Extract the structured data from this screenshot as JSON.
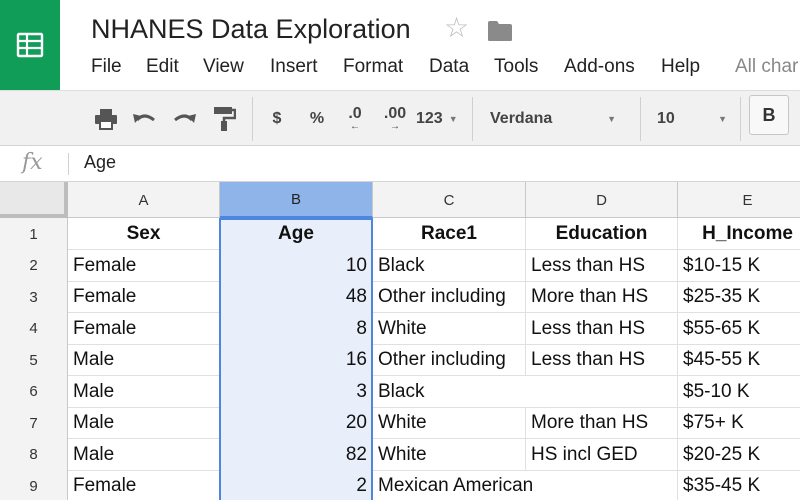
{
  "app": {
    "logo_icon": "sheets-logo-icon",
    "accent": "#0f9d58"
  },
  "document": {
    "title": "NHANES Data Exploration"
  },
  "menu": [
    "File",
    "Edit",
    "View",
    "Insert",
    "Format",
    "Data",
    "Tools",
    "Add-ons",
    "Help",
    "All char"
  ],
  "toolbar": {
    "currency": "$",
    "percent": "%",
    "dec_decrease": ".0",
    "dec_increase": ".00",
    "more_formats": "123",
    "font": "Verdana",
    "font_size": "10",
    "bold": "B"
  },
  "formula_bar": {
    "fx": "fx",
    "value": "Age"
  },
  "columns": [
    "A",
    "B",
    "C",
    "D",
    "E"
  ],
  "selected_column": "B",
  "rows": [
    {
      "num": "1",
      "cells": [
        "Sex",
        "Age",
        "Race1",
        "Education",
        "H_Income"
      ]
    },
    {
      "num": "2",
      "cells": [
        "Female",
        "10",
        "Black",
        "Less than HS",
        "$10-15 K"
      ]
    },
    {
      "num": "3",
      "cells": [
        "Female",
        "48",
        "Other including",
        "More than HS",
        "$25-35 K"
      ]
    },
    {
      "num": "4",
      "cells": [
        "Female",
        "8",
        "White",
        "Less than HS",
        "$55-65 K"
      ]
    },
    {
      "num": "5",
      "cells": [
        "Male",
        "16",
        "Other including",
        "Less than HS",
        "$45-55 K"
      ]
    },
    {
      "num": "6",
      "cells": [
        "Male",
        "3",
        "Black",
        "",
        "$5-10 K"
      ]
    },
    {
      "num": "7",
      "cells": [
        "Male",
        "20",
        "White",
        "More than HS",
        "$75+ K"
      ]
    },
    {
      "num": "8",
      "cells": [
        "Male",
        "82",
        "White",
        "HS incl GED",
        "$20-25 K"
      ]
    },
    {
      "num": "9",
      "cells": [
        "Female",
        "2",
        "Mexican American",
        "",
        "$35-45 K"
      ]
    }
  ]
}
